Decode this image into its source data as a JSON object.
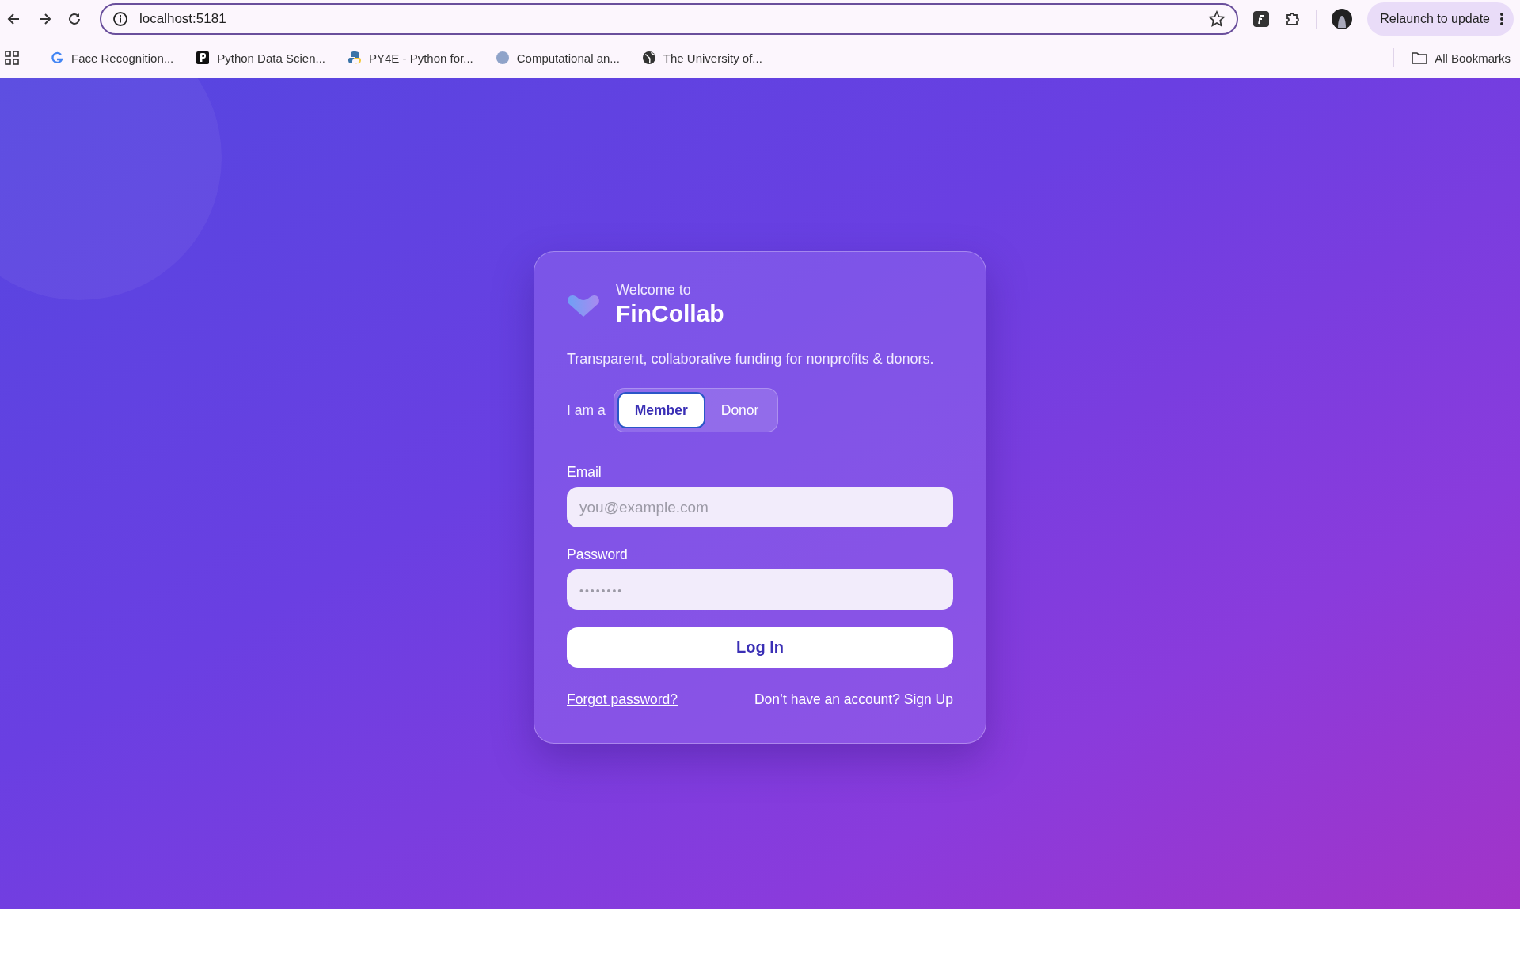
{
  "browser": {
    "url": "localhost:5181",
    "relaunch_label": "Relaunch to update",
    "bookmarks": [
      {
        "label": "Face Recognition..."
      },
      {
        "label": "Python Data Scien..."
      },
      {
        "label": "PY4E - Python for..."
      },
      {
        "label": "Computational an..."
      },
      {
        "label": "The University of..."
      }
    ],
    "all_bookmarks": "All Bookmarks"
  },
  "login": {
    "welcome": "Welcome to",
    "brand": "FinCollab",
    "tagline": "Transparent, collaborative funding for nonprofits & donors.",
    "role_label": "I am a",
    "roles": [
      {
        "label": "Member",
        "selected": true
      },
      {
        "label": "Donor",
        "selected": false
      }
    ],
    "fields": [
      {
        "label": "Email",
        "placeholder": "you@example.com",
        "kind": "email"
      },
      {
        "label": "Password",
        "placeholder": "••••••••",
        "kind": "password"
      }
    ],
    "submit": "Log In",
    "forgot": "Forgot password?",
    "signup_prompt": "Don’t have an account?",
    "signup_link": "Sign Up"
  }
}
